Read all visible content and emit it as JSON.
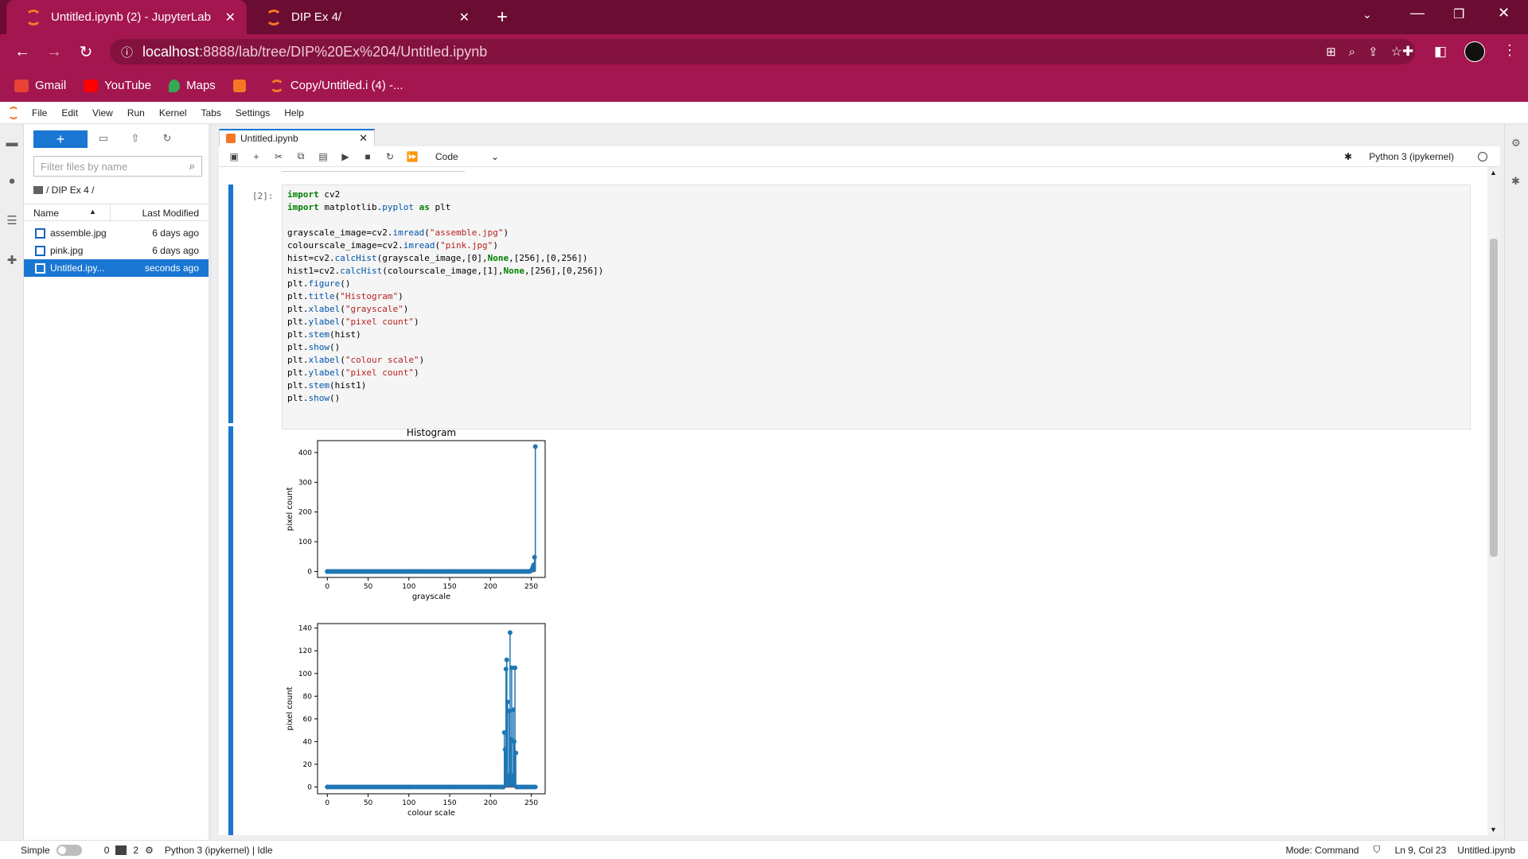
{
  "browser": {
    "tabs": [
      {
        "title": "Untitled.ipynb (2) - JupyterLab",
        "active": true
      },
      {
        "title": "DIP Ex 4/",
        "active": false
      }
    ],
    "url_host": "localhost",
    "url_path": ":8888/lab/tree/DIP%20Ex%204/Untitled.ipynb",
    "bookmarks": [
      "Gmail",
      "YouTube",
      "Maps",
      "",
      "Copy/Untitled.i (4) -..."
    ]
  },
  "jupyter": {
    "menu": [
      "File",
      "Edit",
      "View",
      "Run",
      "Kernel",
      "Tabs",
      "Settings",
      "Help"
    ],
    "filter_placeholder": "Filter files by name",
    "breadcrumb": "/ DIP Ex 4 /",
    "columns": {
      "name": "Name",
      "modified": "Last Modified"
    },
    "files": [
      {
        "name": "assemble.jpg",
        "modified": "6 days ago",
        "selected": false
      },
      {
        "name": "pink.jpg",
        "modified": "6 days ago",
        "selected": false
      },
      {
        "name": "Untitled.ipy...",
        "modified": "seconds ago",
        "selected": true
      }
    ],
    "notebook_tab": "Untitled.ipynb",
    "cell_type": "Code",
    "kernel": "Python 3 (ipykernel)",
    "prompt": "[2]:",
    "code_lines": [
      "import cv2",
      "import matplotlib.pyplot as plt",
      "",
      "grayscale_image=cv2.imread(\"assemble.jpg\")",
      "colourscale_image=cv2.imread(\"pink.jpg\")",
      "hist=cv2.calcHist(grayscale_image,[0],None,[256],[0,256])",
      "hist1=cv2.calcHist(colourscale_image,[1],None,[256],[0,256])",
      "plt.figure()",
      "plt.title(\"Histogram\")",
      "plt.xlabel(\"grayscale\")",
      "plt.ylabel(\"pixel count\")",
      "plt.stem(hist)",
      "plt.show()",
      "plt.xlabel(\"colour scale\")",
      "plt.ylabel(\"pixel count\")",
      "plt.stem(hist1)",
      "plt.show()"
    ],
    "status": {
      "mode_label": "Simple",
      "count1": "0",
      "count2": "2",
      "kernel_status": "Python 3 (ipykernel) | Idle",
      "mode": "Mode: Command",
      "cursor": "Ln 9, Col 23",
      "file": "Untitled.ipynb"
    }
  },
  "chart_data": [
    {
      "type": "stem",
      "title": "Histogram",
      "xlabel": "grayscale",
      "ylabel": "pixel count",
      "xlim": [
        -12,
        267
      ],
      "ylim": [
        -20,
        440
      ],
      "xticks": [
        0,
        50,
        100,
        150,
        200,
        250
      ],
      "yticks": [
        0,
        100,
        200,
        300,
        400
      ],
      "points": [
        [
          0,
          0
        ],
        [
          50,
          0
        ],
        [
          100,
          0
        ],
        [
          150,
          0
        ],
        [
          200,
          0
        ],
        [
          240,
          0
        ],
        [
          250,
          3
        ],
        [
          251,
          8
        ],
        [
          252,
          15
        ],
        [
          253,
          22
        ],
        [
          254,
          48
        ],
        [
          255,
          420
        ]
      ],
      "color": "#1f77b4"
    },
    {
      "type": "stem",
      "title": "",
      "xlabel": "colour scale",
      "ylabel": "pixel count",
      "xlim": [
        -12,
        267
      ],
      "ylim": [
        -6,
        144
      ],
      "xticks": [
        0,
        50,
        100,
        150,
        200,
        250
      ],
      "yticks": [
        0,
        20,
        40,
        60,
        80,
        100,
        120,
        140
      ],
      "points": [
        [
          0,
          0
        ],
        [
          50,
          0
        ],
        [
          100,
          0
        ],
        [
          150,
          0
        ],
        [
          200,
          0
        ],
        [
          215,
          0
        ],
        [
          217,
          48
        ],
        [
          218,
          33
        ],
        [
          219,
          104
        ],
        [
          220,
          112
        ],
        [
          221,
          75
        ],
        [
          222,
          10
        ],
        [
          223,
          67
        ],
        [
          224,
          136
        ],
        [
          225,
          42
        ],
        [
          226,
          105
        ],
        [
          227,
          10
        ],
        [
          228,
          68
        ],
        [
          229,
          40
        ],
        [
          230,
          105
        ],
        [
          231,
          30
        ],
        [
          232,
          0
        ],
        [
          240,
          0
        ],
        [
          255,
          0
        ]
      ],
      "color": "#1f77b4"
    }
  ]
}
